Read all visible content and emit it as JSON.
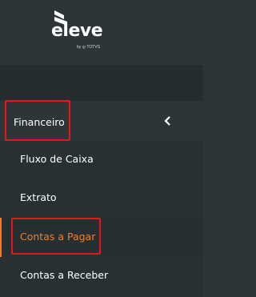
{
  "brand": {
    "name": "eleve",
    "sub": "by ◎ TOTVS"
  },
  "colors": {
    "background": "#2d3538",
    "search_bar": "#262d30",
    "submenu_bg": "#293034",
    "active_bg": "#263033",
    "active_text": "#f07d2b",
    "text": "#ffffff",
    "highlight": "#e8161b"
  },
  "search": {
    "icon": "search-icon"
  },
  "menu": {
    "section": {
      "label": "Financeiro",
      "icon": "chevron-left-icon"
    },
    "items": [
      {
        "label": "Fluxo de Caixa",
        "active": false
      },
      {
        "label": "Extrato",
        "active": false
      },
      {
        "label": "Contas a Pagar",
        "active": true
      },
      {
        "label": "Contas a Receber",
        "active": false
      }
    ]
  }
}
